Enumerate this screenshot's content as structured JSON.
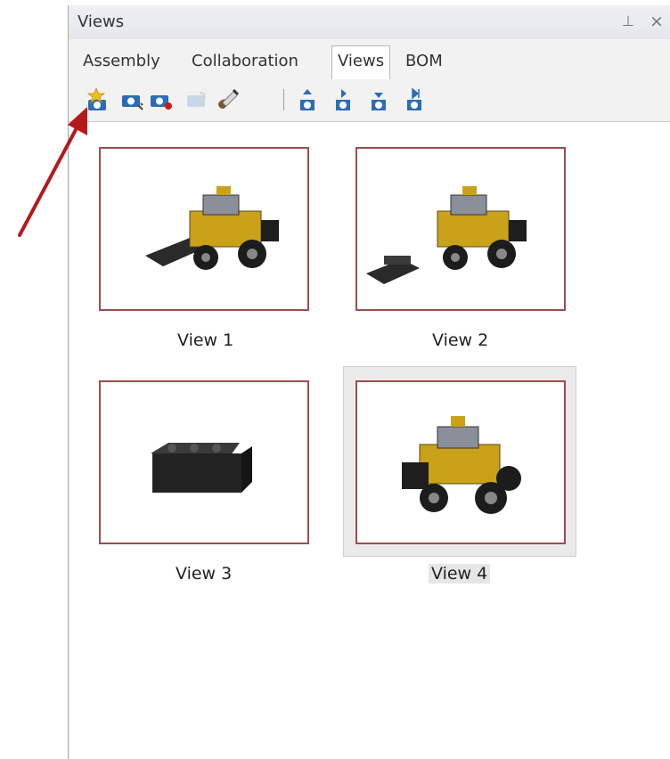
{
  "panel": {
    "title": "Views",
    "pin_glyph": "⊥",
    "close_glyph": "×"
  },
  "tabs": [
    {
      "label": "Assembly",
      "active": false
    },
    {
      "label": "Collaboration",
      "active": false
    },
    {
      "label": "Views",
      "active": true
    },
    {
      "label": "BOM",
      "active": false
    }
  ],
  "toolbar": {
    "buttons": [
      {
        "icon": "new-view-icon"
      },
      {
        "icon": "capture-view-icon"
      },
      {
        "icon": "record-view-icon"
      },
      {
        "icon": "link-view-icon-disabled"
      },
      {
        "icon": "paint-brush-icon"
      },
      {
        "icon": "move-up-icon"
      },
      {
        "icon": "move-next-icon"
      },
      {
        "icon": "move-down-icon"
      },
      {
        "icon": "move-last-icon"
      }
    ]
  },
  "views": [
    {
      "label": "View 1",
      "selected": false
    },
    {
      "label": "View 2",
      "selected": false
    },
    {
      "label": "View 3",
      "selected": false
    },
    {
      "label": "View 4",
      "selected": true
    }
  ],
  "colors": {
    "thumb_border": "#9a4e4e",
    "arrow": "#b51a1a",
    "icon_blue": "#2d6db5",
    "vehicle_yellow": "#c9a21a"
  }
}
